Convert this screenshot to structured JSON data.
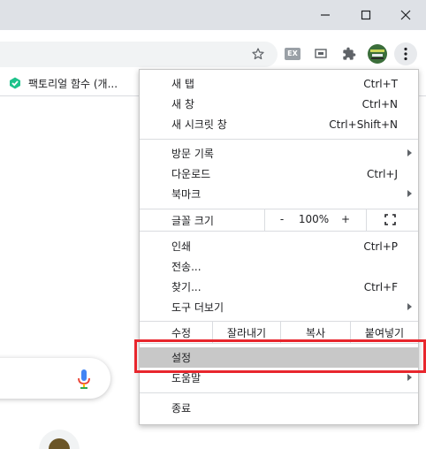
{
  "colors": {
    "titlebar": "#dee1e6",
    "highlight": "#e8262d",
    "settings_hover": "#c8c8c8",
    "accent": "#1a73e8"
  },
  "window_controls": {
    "minimize_icon": "minimize-icon",
    "maximize_icon": "maximize-icon",
    "close_icon": "close-icon"
  },
  "toolbar": {
    "star_icon": "star-icon",
    "extension_badge": "EX",
    "icons": [
      "star-icon",
      "ex-extension-icon",
      "media-icon",
      "puzzle-icon",
      "profile-avatar",
      "kebab-menu-icon"
    ]
  },
  "bookmarks": {
    "item_label": "팩토리얼 함수 (개..."
  },
  "menu": {
    "new_tab": {
      "label": "새 탭",
      "shortcut": "Ctrl+T"
    },
    "new_window": {
      "label": "새 창",
      "shortcut": "Ctrl+N"
    },
    "incognito": {
      "label": "새 시크릿 창",
      "shortcut": "Ctrl+Shift+N"
    },
    "history": {
      "label": "방문 기록"
    },
    "downloads": {
      "label": "다운로드",
      "shortcut": "Ctrl+J"
    },
    "bookmarks": {
      "label": "북마크"
    },
    "zoom": {
      "label": "글꼴 크기",
      "minus": "-",
      "value": "100%",
      "plus": "+"
    },
    "print": {
      "label": "인쇄",
      "shortcut": "Ctrl+P"
    },
    "cast": {
      "label": "전송..."
    },
    "find": {
      "label": "찾기...",
      "shortcut": "Ctrl+F"
    },
    "more_tools": {
      "label": "도구 더보기"
    },
    "edit": {
      "label": "수정",
      "cut": "잘라내기",
      "copy": "복사",
      "paste": "붙여넣기"
    },
    "settings": {
      "label": "설정"
    },
    "help": {
      "label": "도움말"
    },
    "exit": {
      "label": "종료"
    }
  }
}
